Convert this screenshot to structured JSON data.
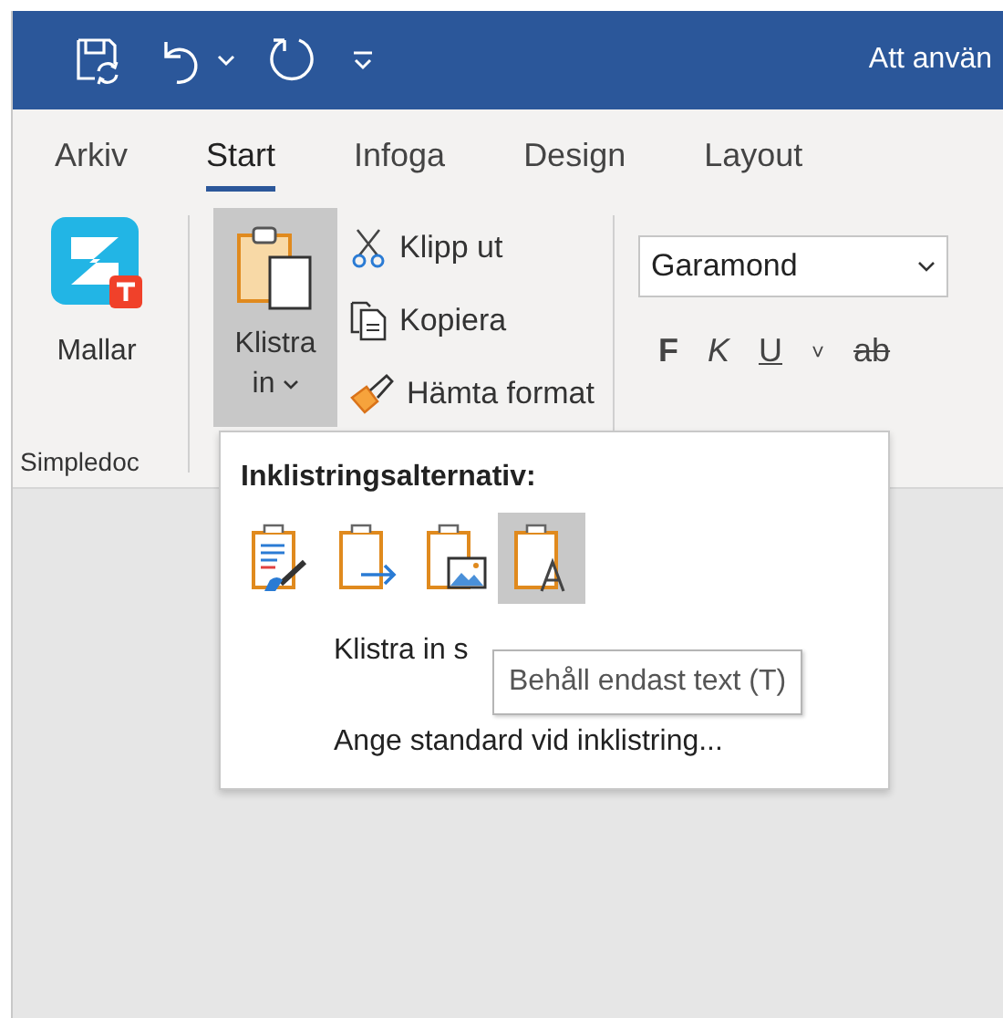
{
  "window": {
    "title": "Att använ"
  },
  "tabs": [
    {
      "label": "Arkiv",
      "selected": false
    },
    {
      "label": "Start",
      "selected": true
    },
    {
      "label": "Infoga",
      "selected": false
    },
    {
      "label": "Design",
      "selected": false
    },
    {
      "label": "Layout",
      "selected": false
    }
  ],
  "ribbon": {
    "templates_button": "Mallar",
    "group_label": "Simpledoc",
    "paste_button": {
      "label_line_1": "Klistra",
      "label_line_2": "in",
      "pressed": true
    },
    "clipboard_items": [
      {
        "kind": "cut",
        "label": "Klipp ut"
      },
      {
        "kind": "copy",
        "label": "Kopiera"
      },
      {
        "kind": "format",
        "label": "Hämta format"
      }
    ],
    "font": {
      "value": "Garamond"
    },
    "format_buttons": [
      {
        "kind": "bold",
        "label": "F"
      },
      {
        "kind": "italic",
        "label": "K"
      },
      {
        "kind": "underline",
        "label": "U"
      },
      {
        "kind": "caret",
        "label": "˅"
      },
      {
        "kind": "strike",
        "label": "ab"
      }
    ]
  },
  "paste_menu": {
    "heading": "Inklistringsalternativ:",
    "options": [
      {
        "kind": "keep-source",
        "selected": false
      },
      {
        "kind": "merge",
        "selected": false
      },
      {
        "kind": "picture",
        "selected": false
      },
      {
        "kind": "text-only",
        "selected": true
      }
    ],
    "items": [
      "Klistra in s",
      "Ange standard vid inklistring..."
    ],
    "tooltip": "Behåll endast text (T)"
  }
}
